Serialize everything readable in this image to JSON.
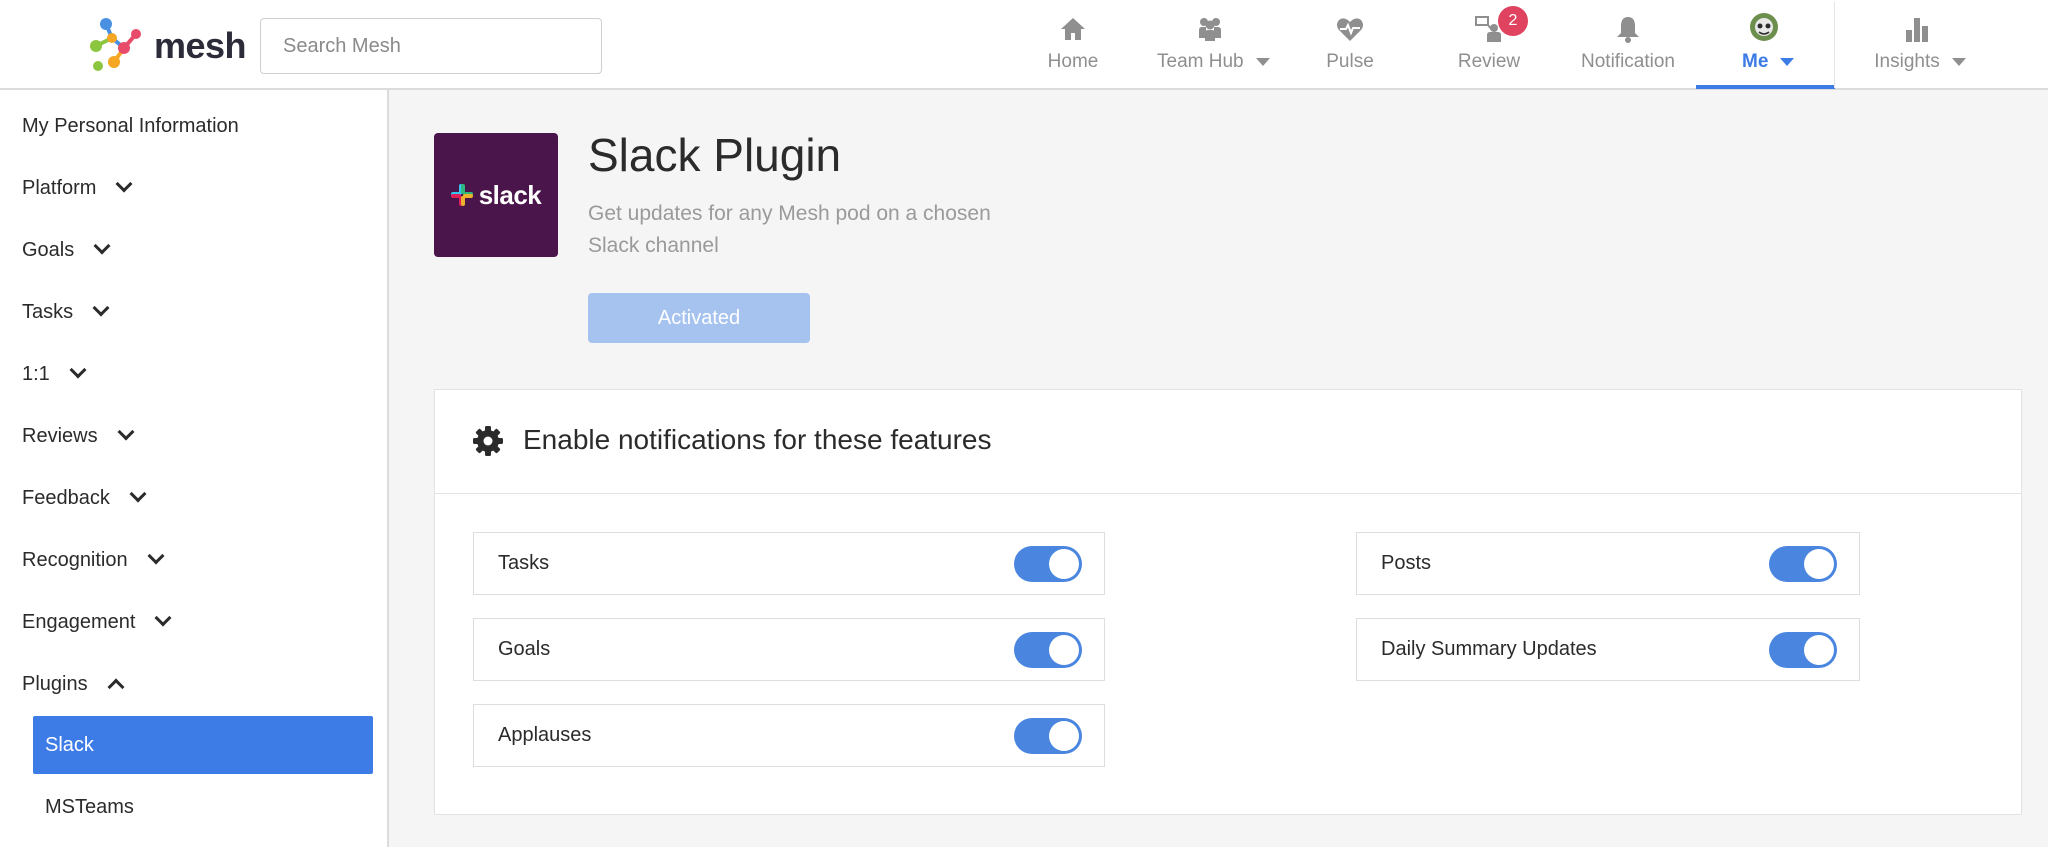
{
  "header": {
    "brand": "mesh",
    "search_placeholder": "Search Mesh",
    "nav": [
      {
        "label": "Home",
        "icon": "home-icon"
      },
      {
        "label": "Team Hub",
        "icon": "team-icon",
        "dropdown": true
      },
      {
        "label": "Pulse",
        "icon": "heart-pulse-icon"
      },
      {
        "label": "Review",
        "icon": "review-icon",
        "badge": "2"
      },
      {
        "label": "Notification",
        "icon": "bell-icon"
      },
      {
        "label": "Me",
        "icon": "avatar",
        "dropdown": true,
        "active": true
      },
      {
        "label": "Insights",
        "icon": "bar-chart-icon",
        "dropdown": true
      }
    ]
  },
  "sidebar": {
    "items": [
      {
        "label": "My Personal Information"
      },
      {
        "label": "Platform"
      },
      {
        "label": "Goals"
      },
      {
        "label": "Tasks"
      },
      {
        "label": "1:1"
      },
      {
        "label": "Reviews"
      },
      {
        "label": "Feedback"
      },
      {
        "label": "Recognition"
      },
      {
        "label": "Engagement"
      },
      {
        "label": "Plugins"
      }
    ],
    "sub_items": [
      {
        "label": "Slack",
        "active": true
      },
      {
        "label": "MSTeams"
      }
    ]
  },
  "plugin": {
    "logo_text": "slack",
    "title": "Slack Plugin",
    "description": "Get updates for any Mesh pod on a chosen Slack channel",
    "status_button": "Activated"
  },
  "notifications": {
    "title": "Enable notifications for these features",
    "toggles": [
      {
        "label": "Tasks",
        "on": true
      },
      {
        "label": "Goals",
        "on": true
      },
      {
        "label": "Applauses",
        "on": true
      },
      {
        "label": "Posts",
        "on": true
      },
      {
        "label": "Daily Summary Updates",
        "on": true
      }
    ]
  },
  "colors": {
    "accent": "#3d7be6",
    "toggle_on": "#4a86e0",
    "slack_bg": "#4a154b",
    "badge": "#e0435f",
    "activated_button": "#a6c3f0"
  }
}
